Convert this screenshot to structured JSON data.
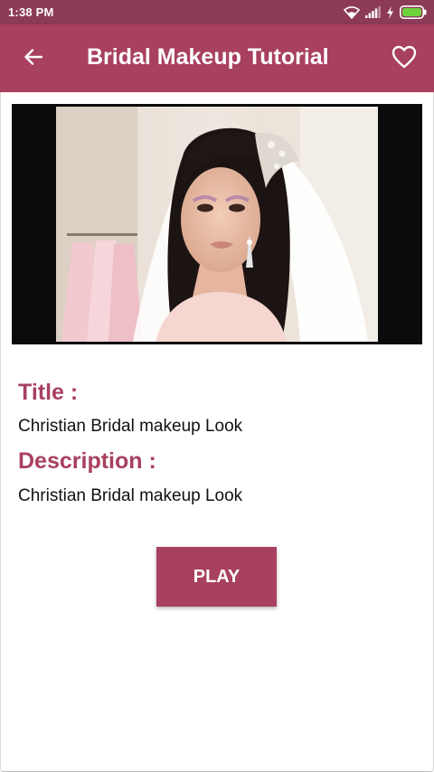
{
  "status_bar": {
    "time": "1:38 PM"
  },
  "app_bar": {
    "title": "Bridal Makeup Tutorial",
    "back_icon": "arrow-back-icon",
    "favorite_icon": "heart-outline-icon"
  },
  "video": {
    "thumbnail": "bridal-makeup-thumbnail"
  },
  "details": {
    "title_label": "Title :",
    "title_value": "Christian Bridal makeup Look",
    "description_label": "Description :",
    "description_value": "Christian Bridal makeup Look"
  },
  "actions": {
    "play_label": "PLAY"
  },
  "colors": {
    "status_bar": "#8c3a57",
    "primary": "#a8405f",
    "background": "#ffffff",
    "text": "#111111"
  }
}
